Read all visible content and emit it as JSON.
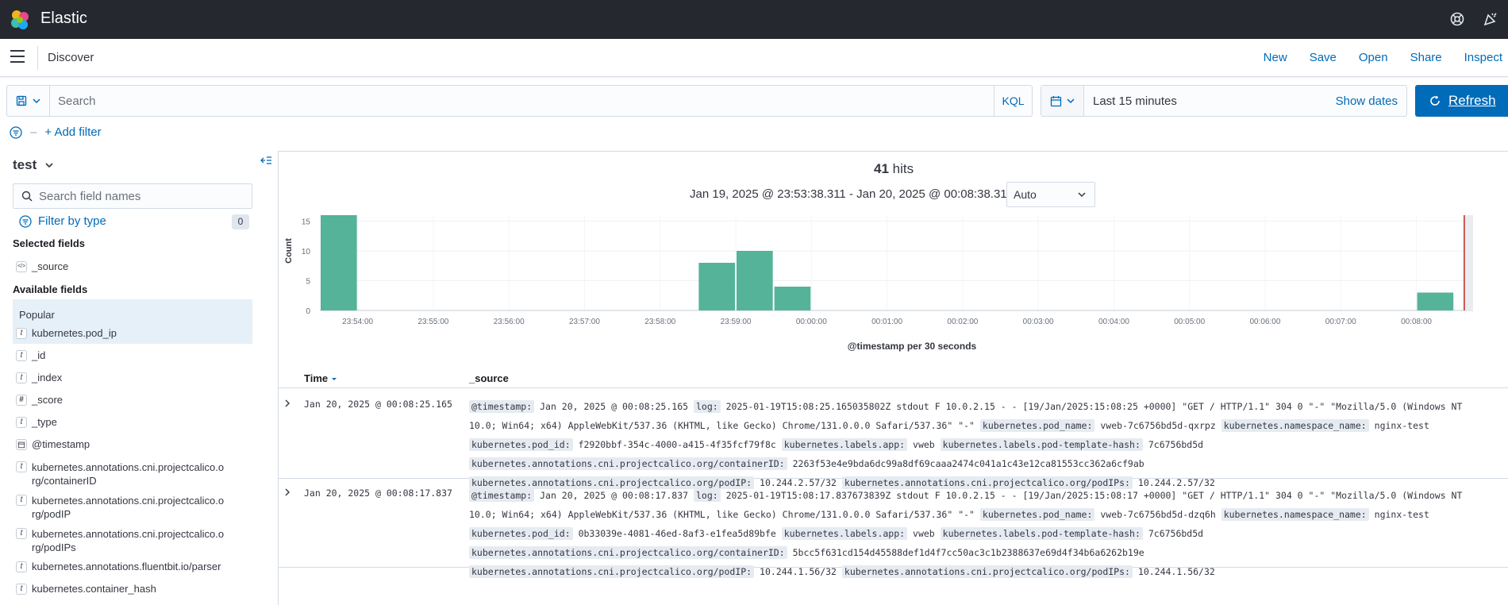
{
  "header": {
    "brand": "Elastic",
    "colors": {
      "bar": "#25282f"
    }
  },
  "subheader": {
    "title": "Discover",
    "links": [
      "New",
      "Save",
      "Open",
      "Share",
      "Inspect"
    ]
  },
  "query": {
    "placeholder": "Search",
    "language": "KQL"
  },
  "time": {
    "range": "Last 15 minutes",
    "show_dates": "Show dates",
    "refresh": "Refresh"
  },
  "filters": {
    "add_label": "+ Add filter"
  },
  "sidebar": {
    "index_pattern": "test",
    "search_placeholder": "Search field names",
    "filter_by_type": "Filter by type",
    "filter_count": "0",
    "selected_title": "Selected fields",
    "selected": [
      {
        "type": "</>",
        "name": "_source"
      }
    ],
    "available_title": "Available fields",
    "popular_title": "Popular",
    "fields": [
      {
        "type": "t",
        "name": "kubernetes.pod_ip"
      },
      {
        "type": "t",
        "name": "_id"
      },
      {
        "type": "t",
        "name": "_index"
      },
      {
        "type": "#",
        "name": "_score"
      },
      {
        "type": "t",
        "name": "_type"
      },
      {
        "type": "cal",
        "name": "@timestamp"
      },
      {
        "type": "t",
        "name": "kubernetes.annotations.cni.projectcalico.org/containerID"
      },
      {
        "type": "t",
        "name": "kubernetes.annotations.cni.projectcalico.org/podIP"
      },
      {
        "type": "t",
        "name": "kubernetes.annotations.cni.projectcalico.org/podIPs"
      },
      {
        "type": "t",
        "name": "kubernetes.annotations.fluentbit.io/parser"
      },
      {
        "type": "t",
        "name": "kubernetes.container_hash"
      }
    ]
  },
  "results": {
    "hits_count": "41",
    "hits_label": "hits",
    "date_range": "Jan 19, 2025 @ 23:53:38.311 - Jan 20, 2025 @ 00:08:38.311",
    "interval": "Auto",
    "columns": {
      "time": "Time",
      "source": "_source"
    }
  },
  "chart_data": {
    "type": "bar",
    "ylabel": "Count",
    "xlabel": "@timestamp per 30 seconds",
    "ylim": [
      0,
      16
    ],
    "yticks": [
      0,
      5,
      10,
      15
    ],
    "xticks": [
      "23:54:00",
      "23:55:00",
      "23:56:00",
      "23:57:00",
      "23:58:00",
      "23:59:00",
      "00:00:00",
      "00:01:00",
      "00:02:00",
      "00:03:00",
      "00:04:00",
      "00:05:00",
      "00:06:00",
      "00:07:00",
      "00:08:00"
    ],
    "x": [
      "23:53:30",
      "23:58:30",
      "23:59:00",
      "23:59:30",
      "00:08:00"
    ],
    "values": [
      16,
      8,
      10,
      4,
      3
    ],
    "bar_color": "#54b399",
    "now_marker": "00:08:38"
  },
  "documents": [
    {
      "time": "Jan 20, 2025 @ 00:08:25.165",
      "lines": [
        [
          [
            "@timestamp:",
            "Jan 20, 2025 @ 00:08:25.165"
          ],
          [
            "log:",
            "2025-01-19T15:08:25.165035802Z stdout F 10.0.2.15 - - [19/Jan/2025:15:08:25 +0000] \"GET / HTTP/1.1\" 304 0 \"-\" \"Mozilla/5.0 (Windows NT"
          ]
        ],
        [
          [
            "",
            "10.0; Win64; x64) AppleWebKit/537.36 (KHTML, like Gecko) Chrome/131.0.0.0 Safari/537.36\" \"-\""
          ],
          [
            "kubernetes.pod_name:",
            "vweb-7c6756bd5d-qxrpz"
          ],
          [
            "kubernetes.namespace_name:",
            "nginx-test"
          ]
        ],
        [
          [
            "kubernetes.pod_id:",
            "f2920bbf-354c-4000-a415-4f35fcf79f8c"
          ],
          [
            "kubernetes.labels.app:",
            "vweb"
          ],
          [
            "kubernetes.labels.pod-template-hash:",
            "7c6756bd5d"
          ]
        ],
        [
          [
            "kubernetes.annotations.cni.projectcalico.org/containerID:",
            "2263f53e4e9bda6dc99a8df69caaa2474c041a1c43e12ca81553cc362a6cf9ab"
          ]
        ],
        [
          [
            "kubernetes.annotations.cni.projectcalico.org/podIP:",
            "10.244.2.57/32"
          ],
          [
            "kubernetes.annotations.cni.projectcalico.org/podIPs:",
            "10.244.2.57/32"
          ]
        ]
      ]
    },
    {
      "time": "Jan 20, 2025 @ 00:08:17.837",
      "lines": [
        [
          [
            "@timestamp:",
            "Jan 20, 2025 @ 00:08:17.837"
          ],
          [
            "log:",
            "2025-01-19T15:08:17.837673839Z stdout F 10.0.2.15 - - [19/Jan/2025:15:08:17 +0000] \"GET / HTTP/1.1\" 304 0 \"-\" \"Mozilla/5.0 (Windows NT"
          ]
        ],
        [
          [
            "",
            "10.0; Win64; x64) AppleWebKit/537.36 (KHTML, like Gecko) Chrome/131.0.0.0 Safari/537.36\" \"-\""
          ],
          [
            "kubernetes.pod_name:",
            "vweb-7c6756bd5d-dzq6h"
          ],
          [
            "kubernetes.namespace_name:",
            "nginx-test"
          ]
        ],
        [
          [
            "kubernetes.pod_id:",
            "0b33039e-4081-46ed-8af3-e1fea5d89bfe"
          ],
          [
            "kubernetes.labels.app:",
            "vweb"
          ],
          [
            "kubernetes.labels.pod-template-hash:",
            "7c6756bd5d"
          ]
        ],
        [
          [
            "kubernetes.annotations.cni.projectcalico.org/containerID:",
            "5bcc5f631cd154d45588def1d4f7cc50ac3c1b2388637e69d4f34b6a6262b19e"
          ]
        ],
        [
          [
            "kubernetes.annotations.cni.projectcalico.org/podIP:",
            "10.244.1.56/32"
          ],
          [
            "kubernetes.annotations.cni.projectcalico.org/podIPs:",
            "10.244.1.56/32"
          ]
        ]
      ]
    }
  ]
}
